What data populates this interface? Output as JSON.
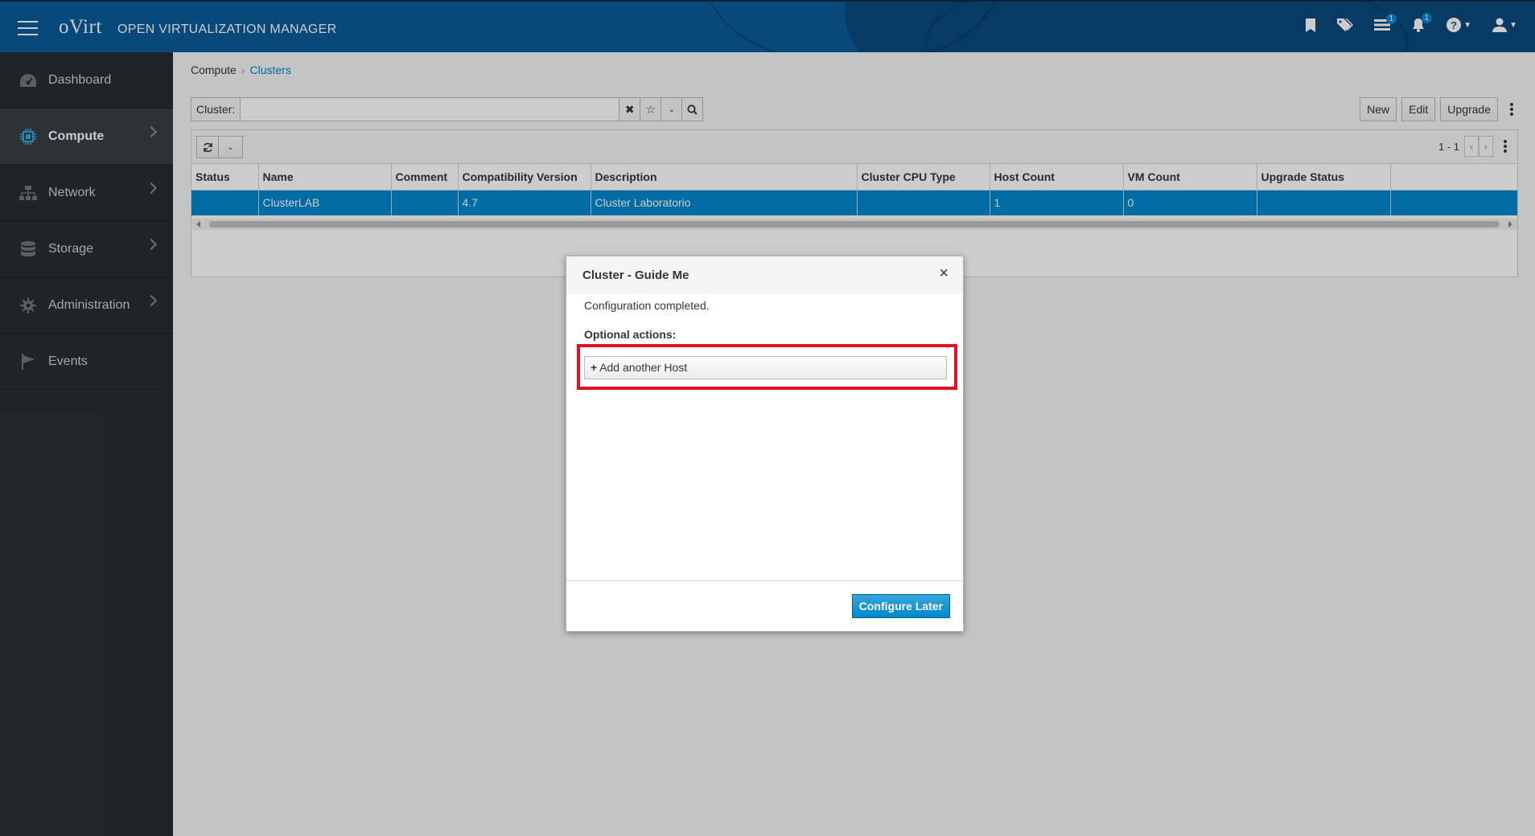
{
  "header": {
    "logo": "oVirt",
    "title": "OPEN VIRTUALIZATION MANAGER",
    "icons": [
      {
        "name": "bookmark-icon"
      },
      {
        "name": "tags-icon"
      },
      {
        "name": "tasks-icon",
        "badge": "1"
      },
      {
        "name": "bell-icon",
        "badge": "1"
      },
      {
        "name": "help-icon"
      },
      {
        "name": "user-icon"
      }
    ]
  },
  "sidebar": {
    "items": [
      {
        "label": "Dashboard",
        "icon": "dashboard-icon"
      },
      {
        "label": "Compute",
        "icon": "compute-icon",
        "active": true
      },
      {
        "label": "Network",
        "icon": "network-icon"
      },
      {
        "label": "Storage",
        "icon": "storage-icon"
      },
      {
        "label": "Administration",
        "icon": "gear-icon"
      },
      {
        "label": "Events",
        "icon": "flag-icon"
      }
    ]
  },
  "breadcrumb": {
    "parent": "Compute",
    "current": "Clusters"
  },
  "search": {
    "label": "Cluster:",
    "value": ""
  },
  "actions": {
    "new": "New",
    "edit": "Edit",
    "upgrade": "Upgrade"
  },
  "pager": {
    "range": "1 - 1"
  },
  "table": {
    "columns": [
      "Status",
      "Name",
      "Comment",
      "Compatibility Version",
      "Description",
      "Cluster CPU Type",
      "Host Count",
      "VM Count",
      "Upgrade Status",
      ""
    ],
    "rows": [
      [
        "",
        "ClusterLAB",
        "",
        "4.7",
        "Cluster Laboratorio",
        "",
        "1",
        "0",
        "",
        ""
      ]
    ]
  },
  "modal": {
    "title": "Cluster - Guide Me",
    "message": "Configuration completed.",
    "optional_title": "Optional actions:",
    "add_host": "Add another Host",
    "configure_later": "Configure Later"
  },
  "colors": {
    "header": "#0a5c9a",
    "sidebar": "#292e34",
    "selected_row": "#0088ce",
    "highlight": "#e0131e"
  }
}
